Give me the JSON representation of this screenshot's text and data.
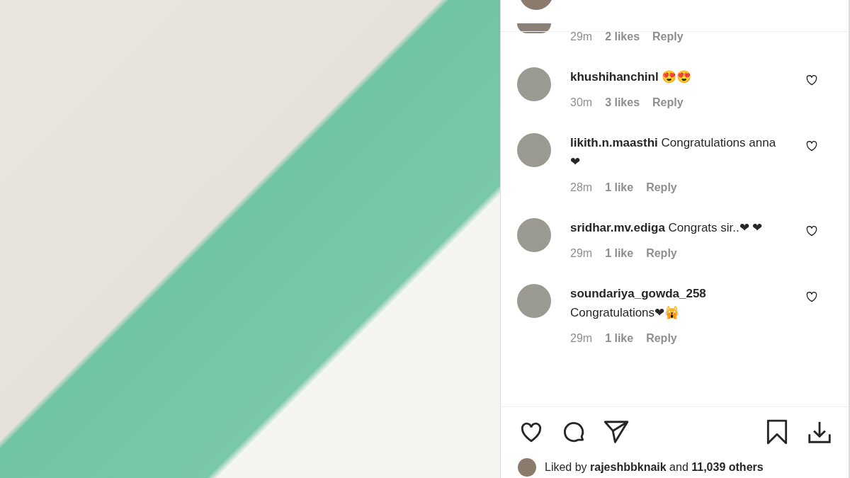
{
  "comments": [
    {
      "time": "29m",
      "likes": "2 likes",
      "reply": "Reply"
    },
    {
      "user": "khushihanchinl",
      "text": "😍😍",
      "time": "30m",
      "likes": "3 likes",
      "reply": "Reply"
    },
    {
      "user": "likith.n.maasthi",
      "text": "Congratulations anna ❤",
      "time": "28m",
      "likes": "1 like",
      "reply": "Reply"
    },
    {
      "user": "sridhar.mv.ediga",
      "text": "Congrats sir..❤ ❤",
      "time": "29m",
      "likes": "1 like",
      "reply": "Reply"
    },
    {
      "user": "soundariya_gowda_258",
      "text": "Congratulations❤🙀",
      "time": "29m",
      "likes": "1 like",
      "reply": "Reply"
    }
  ],
  "liked_by": "Liked by **rajeshbbknaik** and **11,039 others**"
}
